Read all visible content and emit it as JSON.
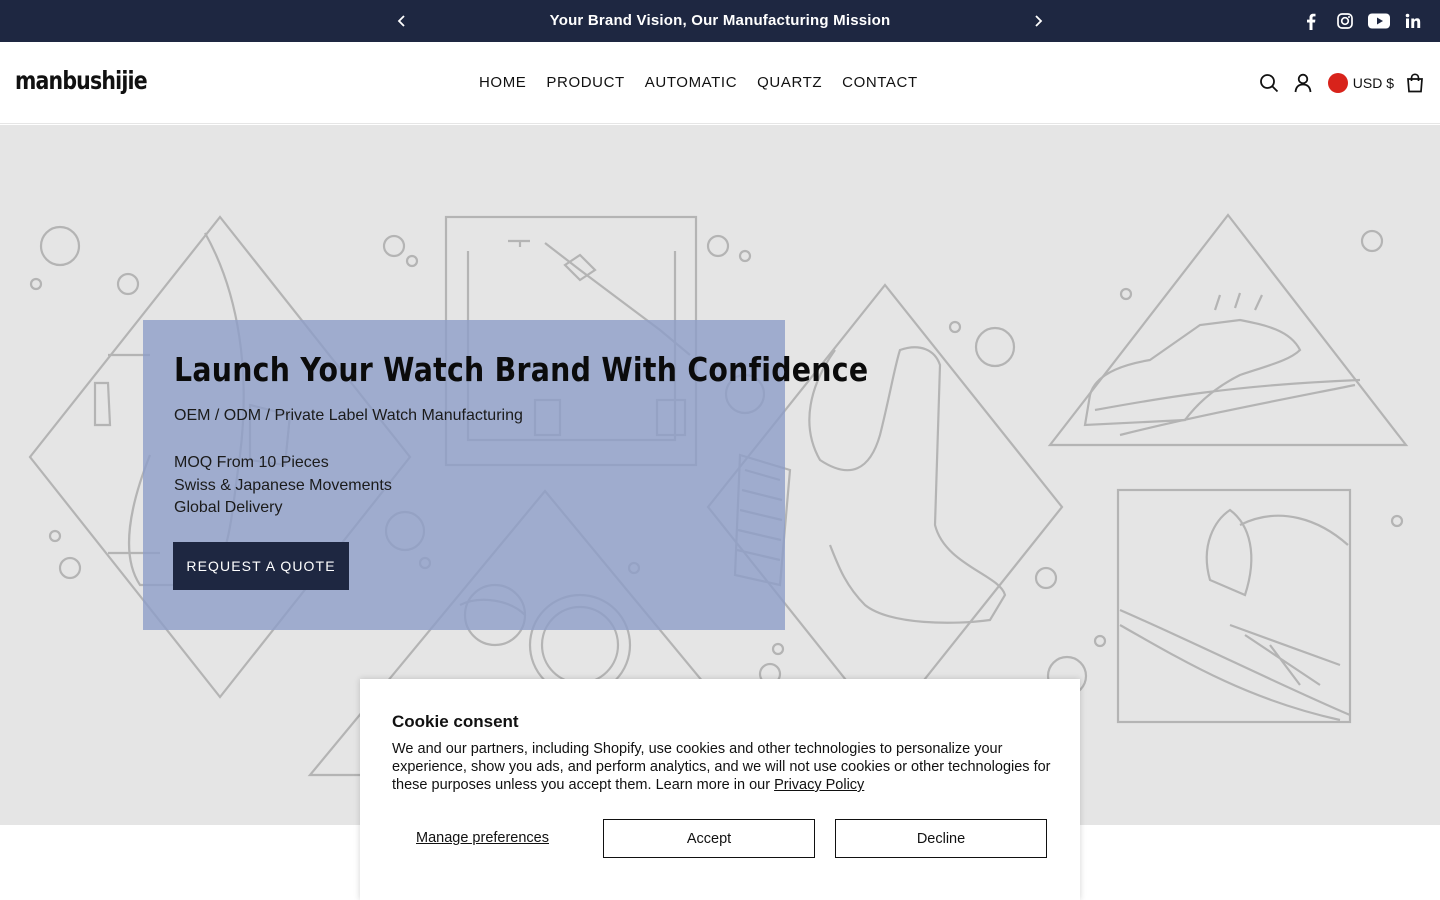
{
  "announcement": {
    "message": "Your Brand Vision, Our Manufacturing Mission",
    "prev_icon": "chevron-left-icon",
    "next_icon": "chevron-right-icon",
    "socials": [
      "facebook-icon",
      "instagram-icon",
      "youtube-icon",
      "linkedin-icon"
    ]
  },
  "header": {
    "logo": "manbushijie",
    "nav": [
      "HOME",
      "PRODUCT",
      "AUTOMATIC",
      "QUARTZ",
      "CONTACT"
    ],
    "tools": [
      "search-icon",
      "account-icon",
      "cart-icon"
    ],
    "currency": "USD $",
    "flag_color": "#d8231b"
  },
  "hero": {
    "title": "Launch Your Watch Brand With Confidence",
    "subtitle": "OEM / ODM / Private Label Watch Manufacturing",
    "points": [
      "MOQ From 10 Pieces",
      "Swiss & Japanese Movements",
      "Global Delivery"
    ],
    "cta": "REQUEST A QUOTE"
  },
  "cookie": {
    "title": "Cookie consent",
    "text": "We and our partners, including Shopify, use cookies and other technologies to personalize your experience, show you ads, and perform analytics, and we will not use cookies or other technologies for these purposes unless you accept them. Learn more in our",
    "privacy_link": "Privacy Policy",
    "manage": "Manage preferences",
    "accept": "Accept",
    "decline": "Decline"
  },
  "colors": {
    "navy": "#1e2741",
    "hero_bg": "#e5e5e5",
    "overlay": "#8c9cc8"
  }
}
